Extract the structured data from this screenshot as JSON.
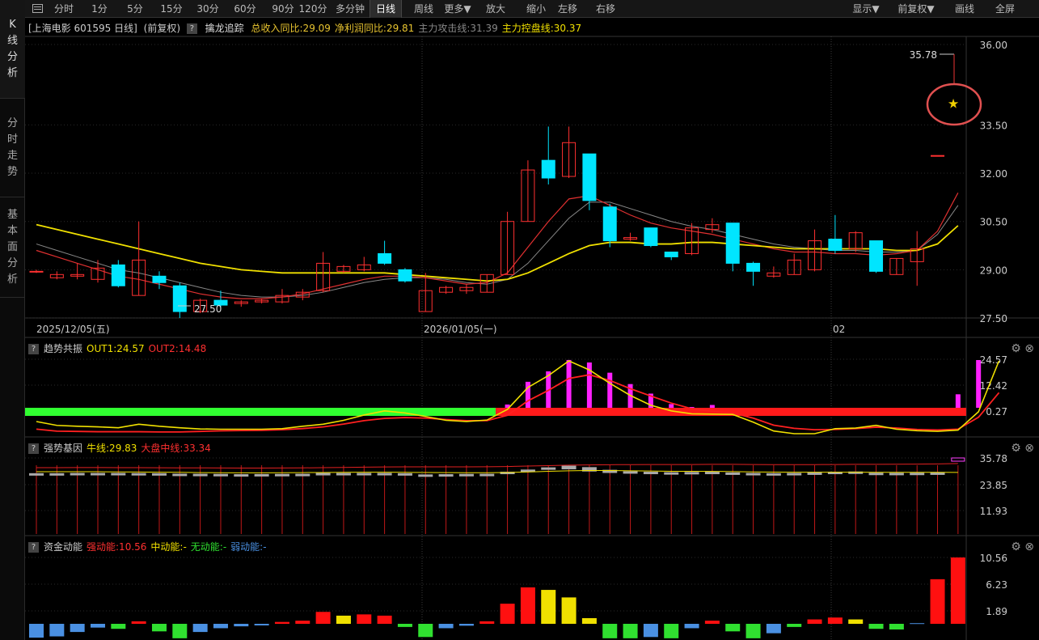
{
  "sidebar": {
    "tabs": [
      {
        "label": "K线分析",
        "chars": [
          "K",
          "线",
          "分",
          "析"
        ],
        "active": true
      },
      {
        "label": "分时走势",
        "chars": [
          "分",
          "时",
          "走",
          "势"
        ],
        "active": false
      },
      {
        "label": "基本面分析",
        "chars": [
          "基",
          "本",
          "面",
          "分",
          "析"
        ],
        "active": false
      }
    ]
  },
  "toolbar": {
    "left": [
      "分时",
      "1分",
      "5分",
      "15分",
      "30分",
      "60分",
      "90分",
      "120分",
      "多分钟",
      "日线",
      "周线",
      "更多▼",
      "放大",
      "缩小",
      "左移",
      "右移"
    ],
    "right": [
      "显示▼",
      "前复权▼",
      "画线",
      "全屏"
    ],
    "active": "日线"
  },
  "main": {
    "title": "[上海电影 601595 日线]",
    "adjust": "(前复权)",
    "indicator": "擒龙追踪",
    "values": [
      {
        "text": "总收入同比:29.09",
        "color": "#e8c430"
      },
      {
        "text": "净利润同比:29.81",
        "color": "#e8c430"
      },
      {
        "text": "主力攻击线:31.39",
        "color": "#888888"
      },
      {
        "text": "主力控盘线:30.37",
        "color": "#f0e000"
      }
    ],
    "price_axis": [
      "36.00",
      "33.50",
      "32.00",
      "30.50",
      "29.00",
      "27.50"
    ],
    "date_labels": [
      "2025/12/05(五)",
      "2026/01/05(一)",
      "02"
    ],
    "high_label": "35.78",
    "low_label": "27.50",
    "star_icon": "star-icon"
  },
  "panel1": {
    "name": "趋势共振",
    "values": [
      {
        "text": "OUT1:24.57",
        "color": "#f0e000"
      },
      {
        "text": "OUT2:14.48",
        "color": "#ff3030"
      }
    ],
    "axis": [
      "24.57",
      "12.42",
      "0.27"
    ]
  },
  "panel2": {
    "name": "强势基因",
    "values": [
      {
        "text": "牛线:29.83",
        "color": "#f0e000"
      },
      {
        "text": "大盘中线:33.34",
        "color": "#ff3030"
      }
    ],
    "axis": [
      "35.78",
      "23.85",
      "11.93"
    ]
  },
  "panel3": {
    "name": "资金动能",
    "values": [
      {
        "text": "强动能:10.56",
        "color": "#ff3030"
      },
      {
        "text": "中动能:-",
        "color": "#f0e000"
      },
      {
        "text": "无动能:-",
        "color": "#30e030"
      },
      {
        "text": "弱动能:-",
        "color": "#4a90e2"
      }
    ],
    "axis": [
      "10.56",
      "6.23",
      "1.89"
    ]
  },
  "icons": {
    "settings": "gear-icon",
    "close": "close-icon",
    "help": "help-icon"
  },
  "chart_data": {
    "type": "candlestick",
    "ylim": [
      27.5,
      36.0
    ],
    "candles": [
      [
        28.95,
        28.95,
        29.0,
        28.9
      ],
      [
        28.75,
        28.85,
        28.95,
        28.7
      ],
      [
        28.8,
        28.85,
        29.2,
        28.7
      ],
      [
        28.7,
        29.05,
        29.3,
        28.6
      ],
      [
        29.15,
        28.5,
        29.3,
        28.45
      ],
      [
        28.2,
        29.3,
        30.5,
        28.2
      ],
      [
        28.8,
        28.6,
        28.95,
        28.4
      ],
      [
        28.5,
        27.7,
        28.6,
        27.5
      ],
      [
        27.7,
        28.05,
        28.1,
        27.65
      ],
      [
        28.05,
        27.9,
        28.35,
        27.8
      ],
      [
        27.95,
        28.0,
        28.05,
        27.85
      ],
      [
        28.0,
        28.05,
        28.1,
        27.95
      ],
      [
        28.0,
        28.2,
        28.4,
        27.95
      ],
      [
        28.15,
        28.3,
        28.4,
        28.05
      ],
      [
        28.35,
        29.2,
        29.55,
        28.3
      ],
      [
        28.95,
        29.1,
        29.15,
        28.9
      ],
      [
        29.0,
        29.15,
        29.4,
        28.95
      ],
      [
        29.5,
        29.2,
        29.9,
        29.15
      ],
      [
        29.0,
        28.65,
        29.05,
        28.6
      ],
      [
        27.7,
        28.35,
        28.9,
        27.7
      ],
      [
        28.3,
        28.45,
        28.5,
        28.25
      ],
      [
        28.35,
        28.45,
        28.55,
        28.25
      ],
      [
        28.3,
        28.85,
        28.85,
        28.3
      ],
      [
        28.85,
        30.5,
        30.8,
        28.85
      ],
      [
        30.5,
        32.1,
        32.4,
        30.5
      ],
      [
        32.4,
        31.85,
        33.45,
        31.65
      ],
      [
        31.9,
        32.95,
        33.45,
        31.85
      ],
      [
        32.6,
        31.15,
        32.6,
        30.85
      ],
      [
        30.95,
        29.9,
        31.05,
        29.7
      ],
      [
        29.95,
        30.0,
        30.15,
        29.9
      ],
      [
        30.3,
        29.75,
        30.3,
        29.7
      ],
      [
        29.55,
        29.4,
        29.55,
        29.3
      ],
      [
        29.5,
        30.3,
        30.45,
        29.45
      ],
      [
        30.25,
        30.4,
        30.6,
        30.15
      ],
      [
        30.45,
        29.2,
        30.45,
        28.95
      ],
      [
        29.2,
        28.95,
        29.25,
        28.5
      ],
      [
        28.8,
        28.9,
        29.1,
        28.75
      ],
      [
        28.85,
        29.3,
        29.5,
        28.85
      ],
      [
        29.0,
        29.9,
        30.25,
        28.95
      ],
      [
        29.95,
        29.6,
        30.7,
        29.5
      ],
      [
        29.65,
        30.15,
        30.2,
        29.55
      ],
      [
        29.9,
        28.95,
        29.9,
        28.9
      ],
      [
        28.85,
        29.35,
        29.35,
        28.85
      ],
      [
        29.25,
        29.65,
        30.2,
        28.5
      ],
      [
        32.55,
        32.55,
        32.55,
        32.55
      ]
    ],
    "ma_gray": [
      29.8,
      29.6,
      29.4,
      29.2,
      29.0,
      28.9,
      28.75,
      28.6,
      28.45,
      28.3,
      28.2,
      28.15,
      28.15,
      28.2,
      28.3,
      28.45,
      28.6,
      28.7,
      28.75,
      28.75,
      28.7,
      28.6,
      28.55,
      28.7,
      29.2,
      29.9,
      30.6,
      31.1,
      31.1,
      30.9,
      30.7,
      30.5,
      30.35,
      30.25,
      30.1,
      29.95,
      29.8,
      29.7,
      29.65,
      29.6,
      29.6,
      29.55,
      29.55,
      29.6,
      30.1,
      31.0
    ],
    "ma_red": [
      29.6,
      29.4,
      29.2,
      29.0,
      28.8,
      28.7,
      28.55,
      28.4,
      28.25,
      28.15,
      28.1,
      28.1,
      28.15,
      28.25,
      28.4,
      28.55,
      28.7,
      28.8,
      28.8,
      28.75,
      28.65,
      28.55,
      28.6,
      28.9,
      29.7,
      30.5,
      31.2,
      31.3,
      31.0,
      30.7,
      30.45,
      30.3,
      30.2,
      30.1,
      29.95,
      29.8,
      29.65,
      29.55,
      29.55,
      29.5,
      29.5,
      29.45,
      29.5,
      29.6,
      30.2,
      31.39
    ],
    "ma_yellow": [
      30.4,
      30.25,
      30.1,
      29.95,
      29.8,
      29.65,
      29.5,
      29.35,
      29.2,
      29.1,
      29.0,
      28.95,
      28.9,
      28.9,
      28.9,
      28.9,
      28.9,
      28.9,
      28.85,
      28.8,
      28.75,
      28.7,
      28.65,
      28.7,
      28.9,
      29.2,
      29.5,
      29.75,
      29.85,
      29.85,
      29.8,
      29.8,
      29.85,
      29.85,
      29.8,
      29.75,
      29.7,
      29.65,
      29.65,
      29.65,
      29.65,
      29.65,
      29.6,
      29.6,
      29.8,
      30.37
    ],
    "trend_out1": [
      4.1,
      2.8,
      2.5,
      2.3,
      2.0,
      3.2,
      2.5,
      2.0,
      1.6,
      1.5,
      1.5,
      1.5,
      1.7,
      2.5,
      3.2,
      4.5,
      6.3,
      7.7,
      7.0,
      5.8,
      4.5,
      4.1,
      4.6,
      8.2,
      15.6,
      19.6,
      24.57,
      21.5,
      17.0,
      12.9,
      9.6,
      7.7,
      6.7,
      6.6,
      6.5,
      3.9,
      0.9,
      0.0,
      0.0,
      1.7,
      1.9,
      2.8,
      1.5,
      1.0,
      0.8,
      1.2,
      7.4,
      24.57
    ],
    "trend_out2": [
      1.6,
      0.9,
      0.8,
      0.7,
      0.7,
      0.7,
      0.6,
      0.6,
      0.8,
      1.0,
      1.1,
      1.2,
      1.4,
      1.8,
      2.4,
      3.4,
      4.6,
      5.4,
      5.7,
      5.5,
      5.0,
      4.6,
      4.6,
      6.5,
      11.6,
      15.3,
      19.5,
      20.8,
      18.8,
      15.9,
      13.3,
      10.8,
      8.8,
      7.9,
      7.3,
      5.5,
      3.0,
      1.9,
      1.4,
      1.5,
      1.8,
      2.3,
      2.0,
      1.5,
      1.3,
      1.6,
      5.8,
      14.48
    ],
    "trend_bars": [
      0,
      0,
      0,
      0,
      0,
      0,
      0,
      0,
      0,
      0,
      0,
      0,
      0,
      0,
      0,
      0,
      0,
      0,
      0,
      0,
      0,
      0,
      0,
      5.0,
      15.0,
      19.6,
      24.6,
      23.5,
      19.0,
      14.0,
      9.8,
      5.2,
      3.9,
      4.8,
      0,
      0,
      0,
      0,
      0,
      0,
      0,
      0,
      0,
      0,
      0,
      9.5,
      24.57
    ],
    "gene_bars": [
      [
        29.0,
        29.0
      ],
      [
        29.0,
        29.0
      ],
      [
        29.1,
        29.1
      ],
      [
        29.1,
        29.1
      ],
      [
        29.1,
        29.1
      ],
      [
        29.05,
        29.05
      ],
      [
        29.0,
        29.0
      ],
      [
        28.8,
        28.8
      ],
      [
        28.75,
        28.75
      ],
      [
        28.7,
        28.7
      ],
      [
        28.6,
        28.6
      ],
      [
        28.65,
        28.65
      ],
      [
        28.7,
        28.7
      ],
      [
        28.75,
        28.75
      ],
      [
        29.1,
        29.1
      ],
      [
        29.1,
        29.1
      ],
      [
        29.1,
        29.1
      ],
      [
        29.1,
        29.1
      ],
      [
        29.0,
        29.0
      ],
      [
        28.5,
        28.5
      ],
      [
        28.6,
        28.6
      ],
      [
        28.7,
        28.7
      ],
      [
        28.75,
        28.75
      ],
      [
        29.6,
        29.6
      ],
      [
        30.5,
        30.5
      ],
      [
        31.4,
        31.4
      ],
      [
        32.1,
        31.6
      ],
      [
        31.5,
        30.7
      ],
      [
        30.4,
        30.1
      ],
      [
        29.8,
        29.8
      ],
      [
        29.6,
        29.6
      ],
      [
        29.4,
        29.4
      ],
      [
        29.5,
        29.5
      ],
      [
        29.6,
        29.6
      ],
      [
        29.3,
        29.3
      ],
      [
        29.1,
        29.1
      ],
      [
        29.0,
        29.0
      ],
      [
        29.1,
        29.1
      ],
      [
        29.3,
        29.3
      ],
      [
        29.6,
        29.6
      ],
      [
        29.7,
        29.7
      ],
      [
        29.2,
        29.2
      ],
      [
        29.15,
        29.15
      ],
      [
        29.2,
        29.2
      ],
      [
        29.3,
        29.3
      ],
      [
        35.78,
        33.34
      ]
    ],
    "gene_yellow": [
      30.1,
      30.1,
      30.1,
      30.1,
      30.05,
      30.0,
      29.9,
      29.85,
      29.75,
      29.7,
      29.65,
      29.65,
      29.7,
      29.75,
      29.8,
      29.85,
      29.9,
      29.9,
      29.85,
      29.8,
      29.75,
      29.7,
      29.7,
      29.8,
      30.0,
      30.3,
      30.5,
      30.6,
      30.6,
      30.5,
      30.4,
      30.3,
      30.3,
      30.25,
      30.15,
      30.05,
      29.95,
      29.9,
      29.9,
      29.9,
      29.9,
      29.85,
      29.85,
      29.85,
      29.85,
      29.83
    ],
    "gene_red": [
      31.5,
      31.5,
      31.55,
      31.55,
      31.5,
      31.5,
      31.45,
      31.4,
      31.4,
      31.35,
      31.3,
      31.3,
      31.35,
      31.4,
      31.5,
      31.6,
      31.7,
      31.8,
      31.85,
      31.85,
      31.85,
      31.85,
      31.9,
      32.0,
      32.2,
      32.4,
      32.6,
      32.7,
      32.8,
      32.85,
      32.9,
      32.9,
      32.9,
      32.95,
      32.95,
      32.9,
      32.85,
      32.85,
      32.85,
      32.9,
      32.95,
      32.95,
      33.0,
      33.05,
      33.15,
      33.34
    ],
    "money": [
      [
        -2.2,
        "#4a90e2"
      ],
      [
        -2.0,
        "#4a90e2"
      ],
      [
        -1.3,
        "#4a90e2"
      ],
      [
        -0.6,
        "#4a90e2"
      ],
      [
        -0.8,
        "#30e030"
      ],
      [
        0.4,
        "#ff1010"
      ],
      [
        -1.2,
        "#30e030"
      ],
      [
        -2.3,
        "#30e030"
      ],
      [
        -1.3,
        "#4a90e2"
      ],
      [
        -0.7,
        "#4a90e2"
      ],
      [
        -0.4,
        "#4a90e2"
      ],
      [
        -0.25,
        "#4a90e2"
      ],
      [
        0.3,
        "#ff1010"
      ],
      [
        0.5,
        "#ff1010"
      ],
      [
        1.9,
        "#ff1010"
      ],
      [
        1.3,
        "#f0e000"
      ],
      [
        1.5,
        "#ff1010"
      ],
      [
        1.3,
        "#ff1010"
      ],
      [
        -0.5,
        "#30e030"
      ],
      [
        -2.1,
        "#30e030"
      ],
      [
        -0.7,
        "#4a90e2"
      ],
      [
        -0.3,
        "#4a90e2"
      ],
      [
        0.4,
        "#ff1010"
      ],
      [
        3.2,
        "#ff1010"
      ],
      [
        5.8,
        "#ff1010"
      ],
      [
        5.4,
        "#f0e000"
      ],
      [
        4.2,
        "#f0e000"
      ],
      [
        0.9,
        "#f0e000"
      ],
      [
        -2.3,
        "#30e030"
      ],
      [
        -2.3,
        "#30e030"
      ],
      [
        -2.1,
        "#4a90e2"
      ],
      [
        -2.3,
        "#30e030"
      ],
      [
        -0.7,
        "#4a90e2"
      ],
      [
        0.5,
        "#ff1010"
      ],
      [
        -1.2,
        "#30e030"
      ],
      [
        -2.3,
        "#30e030"
      ],
      [
        -1.5,
        "#4a90e2"
      ],
      [
        -0.5,
        "#30e030"
      ],
      [
        0.7,
        "#ff1010"
      ],
      [
        1.0,
        "#ff1010"
      ],
      [
        0.7,
        "#f0e000"
      ],
      [
        -0.8,
        "#30e030"
      ],
      [
        -0.9,
        "#30e030"
      ],
      [
        0.1,
        "#4a90e2"
      ],
      [
        7.1,
        "#ff1010"
      ],
      [
        10.56,
        "#ff1010"
      ]
    ]
  }
}
